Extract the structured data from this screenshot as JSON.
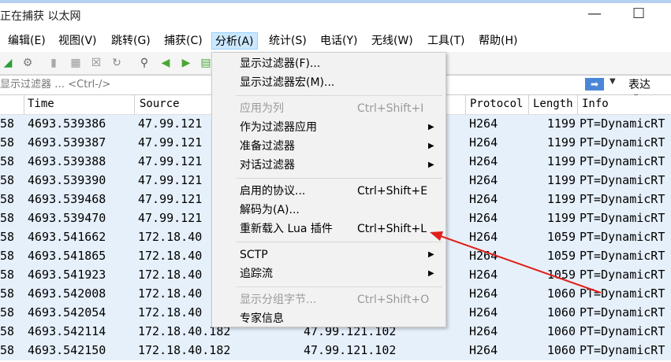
{
  "window": {
    "title": "正在捕获 以太网"
  },
  "menubar": [
    {
      "label": "编辑(E)"
    },
    {
      "label": "视图(V)"
    },
    {
      "label": "跳转(G)"
    },
    {
      "label": "捕获(C)"
    },
    {
      "label": "分析(A)"
    },
    {
      "label": "统计(S)"
    },
    {
      "label": "电话(Y)"
    },
    {
      "label": "无线(W)"
    },
    {
      "label": "工具(T)"
    },
    {
      "label": "帮助(H)"
    }
  ],
  "filter": {
    "placeholder": "显示过滤器 … <Ctrl-/>",
    "expression_label": "表达式…"
  },
  "columns": {
    "time": "Time",
    "source": "Source",
    "protocol": "Protocol",
    "length": "Length",
    "info": "Info"
  },
  "packets": [
    {
      "no": "58",
      "time": "4693.539386",
      "source": "47.99.121",
      "destination": "",
      "protocol": "H264",
      "length": "1199",
      "info": "PT=DynamicRT"
    },
    {
      "no": "58",
      "time": "4693.539387",
      "source": "47.99.121",
      "destination": "",
      "protocol": "H264",
      "length": "1199",
      "info": "PT=DynamicRT"
    },
    {
      "no": "58",
      "time": "4693.539388",
      "source": "47.99.121",
      "destination": "",
      "protocol": "H264",
      "length": "1199",
      "info": "PT=DynamicRT"
    },
    {
      "no": "58",
      "time": "4693.539390",
      "source": "47.99.121",
      "destination": "",
      "protocol": "H264",
      "length": "1199",
      "info": "PT=DynamicRT"
    },
    {
      "no": "58",
      "time": "4693.539468",
      "source": "47.99.121",
      "destination": "",
      "protocol": "H264",
      "length": "1199",
      "info": "PT=DynamicRT"
    },
    {
      "no": "58",
      "time": "4693.539470",
      "source": "47.99.121",
      "destination": "",
      "protocol": "H264",
      "length": "1199",
      "info": "PT=DynamicRT"
    },
    {
      "no": "58",
      "time": "4693.541662",
      "source": "172.18.40",
      "destination": "",
      "protocol": "H264",
      "length": "1059",
      "info": "PT=DynamicRT"
    },
    {
      "no": "58",
      "time": "4693.541865",
      "source": "172.18.40",
      "destination": "",
      "protocol": "H264",
      "length": "1059",
      "info": "PT=DynamicRT"
    },
    {
      "no": "58",
      "time": "4693.541923",
      "source": "172.18.40",
      "destination": "",
      "protocol": "H264",
      "length": "1059",
      "info": "PT=DynamicRT"
    },
    {
      "no": "58",
      "time": "4693.542008",
      "source": "172.18.40",
      "destination": "",
      "protocol": "H264",
      "length": "1060",
      "info": "PT=DynamicRT"
    },
    {
      "no": "58",
      "time": "4693.542054",
      "source": "172.18.40",
      "destination": "",
      "protocol": "H264",
      "length": "1060",
      "info": "PT=DynamicRT"
    },
    {
      "no": "58",
      "time": "4693.542114",
      "source": "172.18.40.182",
      "destination": "47.99.121.102",
      "protocol": "H264",
      "length": "1060",
      "info": "PT=DynamicRT"
    },
    {
      "no": "58",
      "time": "4693.542150",
      "source": "172.18.40.182",
      "destination": "47.99.121.102",
      "protocol": "H264",
      "length": "1060",
      "info": "PT=DynamicRT"
    }
  ],
  "analyze_menu": [
    {
      "label": "显示过滤器(F)...",
      "shortcut": "",
      "submenu": false,
      "disabled": false
    },
    {
      "label": "显示过滤器宏(M)...",
      "shortcut": "",
      "submenu": false,
      "disabled": false
    },
    {
      "separator": true
    },
    {
      "label": "应用为列",
      "shortcut": "Ctrl+Shift+I",
      "submenu": false,
      "disabled": true
    },
    {
      "label": "作为过滤器应用",
      "shortcut": "",
      "submenu": true,
      "disabled": false
    },
    {
      "label": "准备过滤器",
      "shortcut": "",
      "submenu": true,
      "disabled": false
    },
    {
      "label": "对话过滤器",
      "shortcut": "",
      "submenu": true,
      "disabled": false
    },
    {
      "separator": true
    },
    {
      "label": "启用的协议...",
      "shortcut": "Ctrl+Shift+E",
      "submenu": false,
      "disabled": false
    },
    {
      "label": "解码为(A)...",
      "shortcut": "",
      "submenu": false,
      "disabled": false
    },
    {
      "label": "重新载入 Lua 插件",
      "shortcut": "Ctrl+Shift+L",
      "submenu": false,
      "disabled": false
    },
    {
      "separator": true
    },
    {
      "label": "SCTP",
      "shortcut": "",
      "submenu": true,
      "disabled": false
    },
    {
      "label": "追踪流",
      "shortcut": "",
      "submenu": true,
      "disabled": false
    },
    {
      "separator": true
    },
    {
      "label": "显示分组字节...",
      "shortcut": "Ctrl+Shift+O",
      "submenu": false,
      "disabled": true
    },
    {
      "label": "专家信息",
      "shortcut": "",
      "submenu": false,
      "disabled": false
    }
  ],
  "colors": {
    "row_bg": "#e6f0fb",
    "menu_highlight": "#cce8ff",
    "annotation_arrow": "#e0201a"
  },
  "icons": [
    "shark-fin-icon",
    "options-gear-icon",
    "stop-icon",
    "open-file-icon",
    "close-file-icon",
    "reload-icon",
    "find-icon",
    "back-arrow-icon",
    "forward-arrow-icon",
    "go-to-packet-icon"
  ]
}
